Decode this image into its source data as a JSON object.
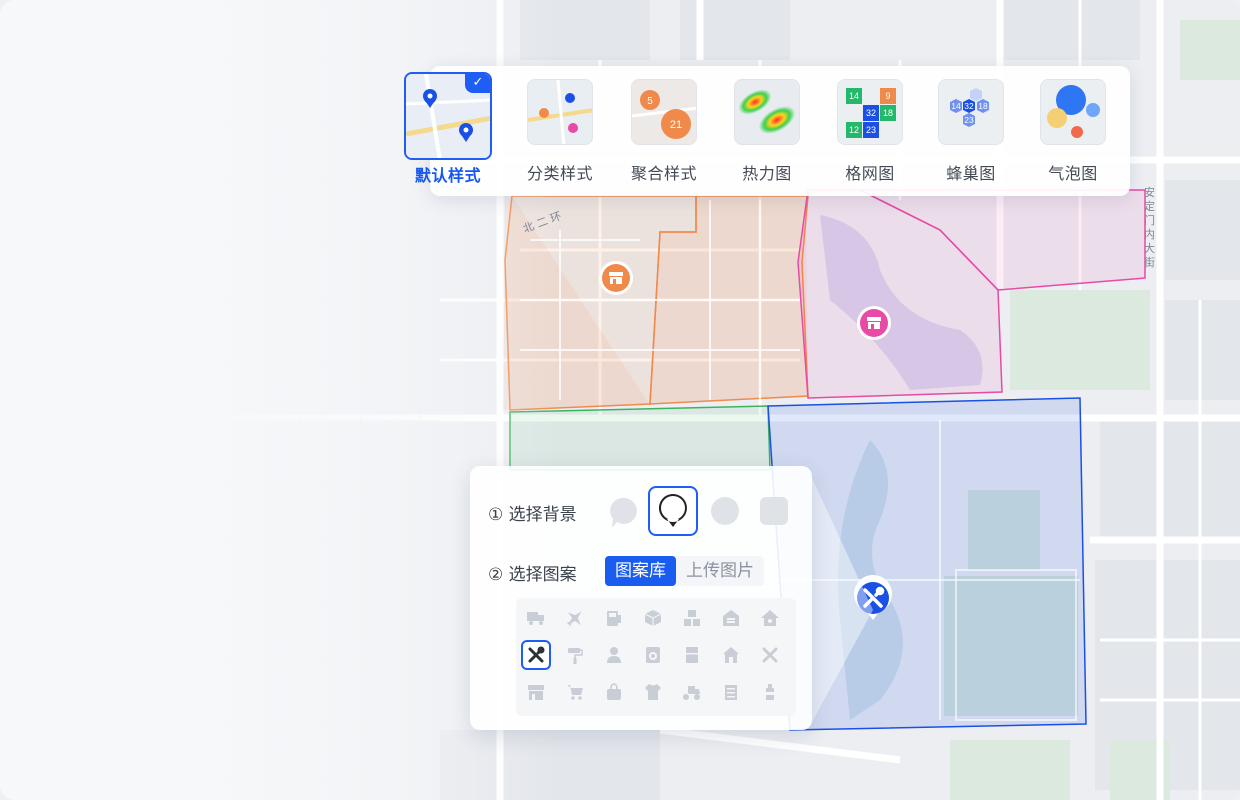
{
  "map": {
    "road_label_north": "北 二 环",
    "road_label_east": "安 定 门 内 大 街",
    "zone_colors": {
      "orange": "#f08a4b",
      "pink": "#e84aa6",
      "green": "#3eb35f",
      "blue": "#1a50e6"
    }
  },
  "style_bar": {
    "items": [
      {
        "label": "默认样式",
        "icon": "default-pin-thumb",
        "active": true
      },
      {
        "label": "分类样式",
        "icon": "category-pin-thumb",
        "active": false
      },
      {
        "label": "聚合样式",
        "icon": "cluster-thumb",
        "active": false
      },
      {
        "label": "热力图",
        "icon": "heatmap-thumb",
        "active": false
      },
      {
        "label": "格网图",
        "icon": "grid-thumb",
        "active": false
      },
      {
        "label": "蜂巢图",
        "icon": "hexbin-thumb",
        "active": false
      },
      {
        "label": "气泡图",
        "icon": "bubble-thumb",
        "active": false
      }
    ],
    "cluster_counts": [
      "5",
      "21"
    ],
    "grid_counts": [
      "14",
      "9",
      "32",
      "18",
      "12",
      "23"
    ],
    "hex_counts": [
      "14",
      "32",
      "18",
      "23"
    ]
  },
  "panel": {
    "step1_label": "① 选择背景",
    "step2_label": "② 选择图案",
    "background_options": [
      "speech-bubble",
      "pin-bubble",
      "circle",
      "rounded-square"
    ],
    "selected_background": "pin-bubble",
    "tabs": [
      "图案库",
      "上传图片"
    ],
    "active_tab": "图案库",
    "icons": [
      [
        "truck-icon",
        "plane-icon",
        "gas-station-icon",
        "box-icon",
        "boxes-icon",
        "warehouse-icon",
        "home-icon"
      ],
      [
        "tools-icon",
        "paint-roller-icon",
        "person-icon",
        "washing-machine-icon",
        "fridge-icon",
        "house-icon",
        "repair-icon"
      ],
      [
        "store-icon",
        "cart-icon",
        "bag-icon",
        "tshirt-icon",
        "delivery-icon",
        "building-icon",
        "bottle-icon"
      ]
    ],
    "selected_icon": "tools-icon"
  }
}
